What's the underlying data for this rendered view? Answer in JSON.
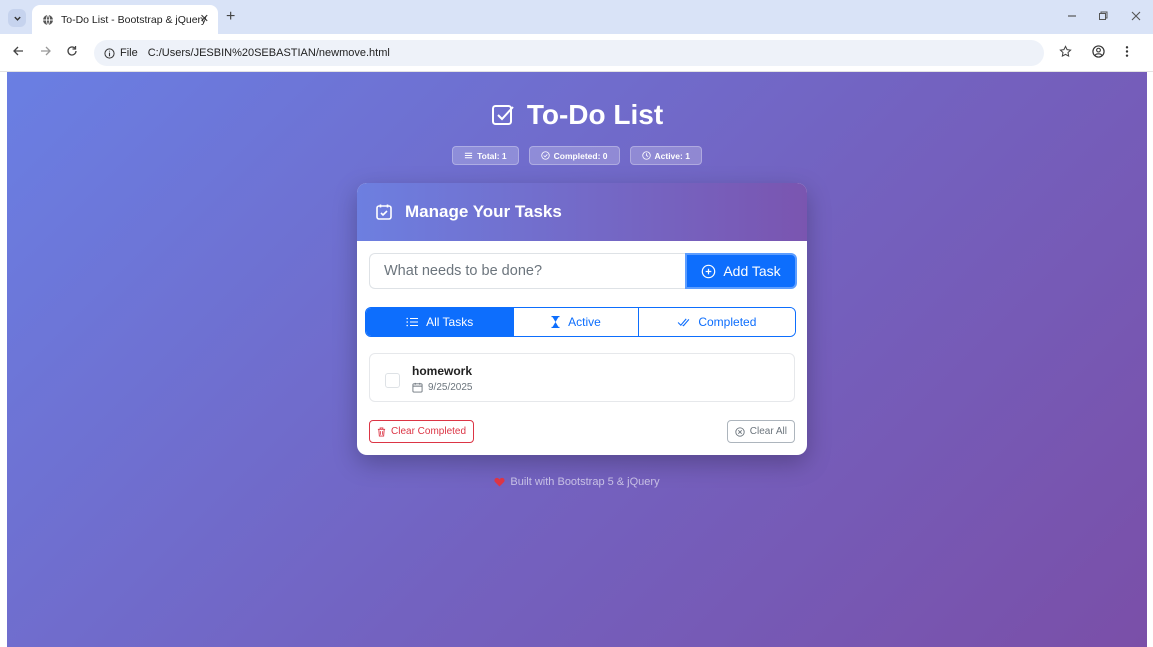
{
  "browser": {
    "tab_title": "To-Do List - Bootstrap & jQuery",
    "tab_close": "✕",
    "new_tab": "+",
    "url_scheme": "File",
    "url": "C:/Users/JESBIN%20SEBASTIAN/newmove.html"
  },
  "app": {
    "title": "To-Do List",
    "stats": {
      "total": "Total: 1",
      "completed": "Completed: 0",
      "active": "Active: 1"
    },
    "card_title": "Manage Your Tasks",
    "input_placeholder": "What needs to be done?",
    "add_button": "Add Task",
    "filters": {
      "all": "All Tasks",
      "active": "Active",
      "completed": "Completed"
    },
    "tasks": [
      {
        "name": "homework",
        "date": "9/25/2025",
        "done": false
      }
    ],
    "clear_completed": "Clear Completed",
    "clear_all": "Clear All",
    "footer": "Built with Bootstrap 5 & jQuery"
  },
  "colors": {
    "primary": "#0d6efd",
    "danger": "#dc3545",
    "gradient_start": "#6a7fe3",
    "gradient_end": "#7a4fa8"
  }
}
